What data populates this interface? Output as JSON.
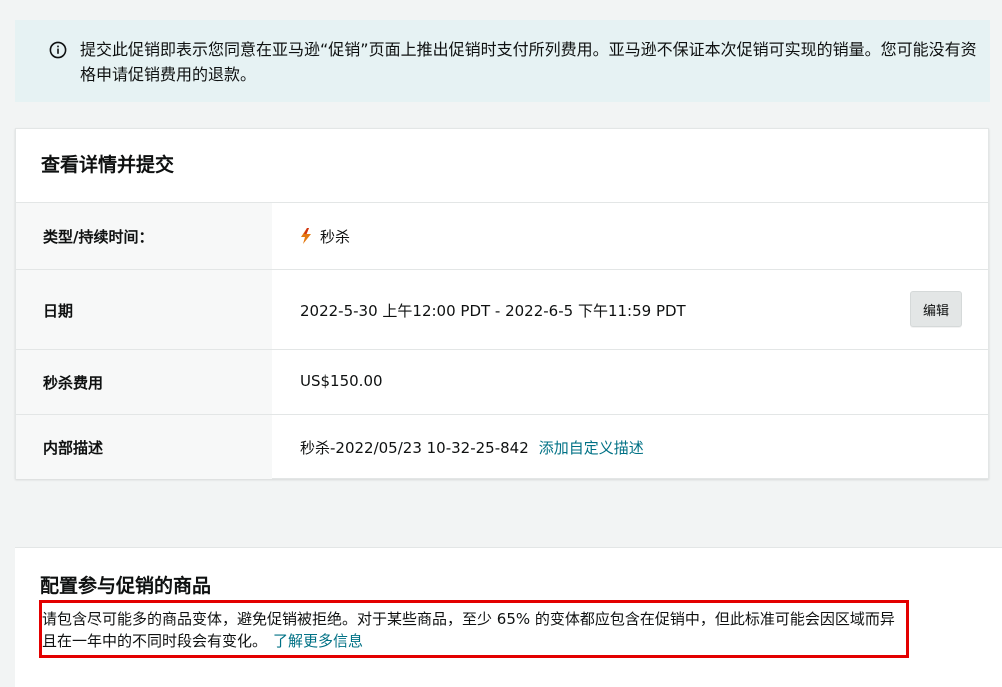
{
  "banner": {
    "icon": "info-icon",
    "text": "提交此促销即表示您同意在亚马逊“促销”页面上推出促销时支付所列费用。亚马逊不保证本次促销可实现的销量。您可能没有资格申请促销费用的退款。"
  },
  "review": {
    "title": "查看详情并提交",
    "rows": [
      {
        "label": "类型/持续时间：",
        "value": "秒杀",
        "icon": "flash-icon",
        "icon_color": "#e47911"
      },
      {
        "label": "日期",
        "value": "2022-5-30 上午12:00 PDT - 2022-6-5 下午11:59 PDT",
        "button": "编辑"
      },
      {
        "label": "秒杀费用",
        "value": "US$150.00"
      },
      {
        "label": "内部描述",
        "value": "秒杀-2022/05/23 10-32-25-842",
        "link": "添加自定义描述"
      }
    ]
  },
  "products": {
    "title": "配置参与促销的商品",
    "note": "请包含尽可能多的商品变体，避免促销被拒绝。对于某些商品，至少 65% 的变体都应包含在促销中，但此标准可能会因区域而异且在一年中的不同时段会有变化。",
    "link": "了解更多信息"
  },
  "colors": {
    "link": "#007185",
    "highlight_border": "#e30000",
    "banner_bg": "#e6f2f3"
  }
}
